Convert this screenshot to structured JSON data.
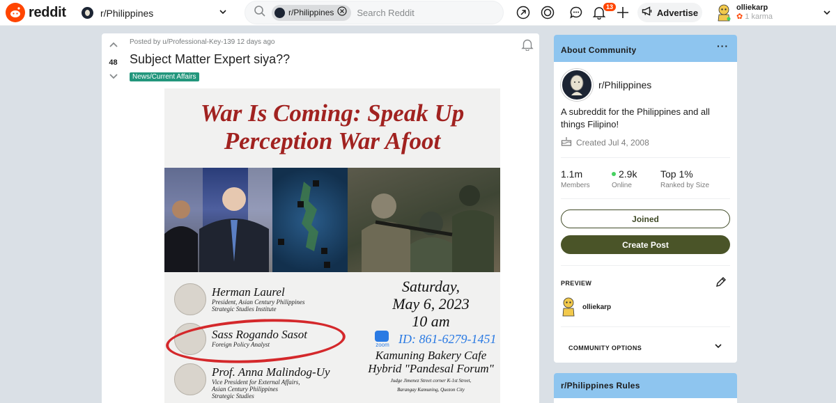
{
  "header": {
    "logo_text": "reddit",
    "community": "r/Philippines",
    "search_chip": "r/Philippines",
    "search_placeholder": "Search Reddit",
    "notification_count": "13",
    "advertise_label": "Advertise",
    "user_name": "olliekarp",
    "user_karma": "1 karma",
    "brand_color": "#ff4500"
  },
  "post": {
    "score": "48",
    "meta": "Posted by u/Professional-Key-139 12 days ago",
    "title": "Subject Matter Expert siya??",
    "flair": "News/Current Affairs",
    "flair_color": "#22967c",
    "image": {
      "headline_1": "War Is Coming: Speak Up",
      "headline_2": "Perception War Afoot",
      "speaker_1_name": "Herman Laurel",
      "speaker_1_role_1": "President, Asian Century Philippines",
      "speaker_1_role_2": "Strategic Studies Institute",
      "speaker_2_name": "Sass Rogando Sasot",
      "speaker_2_role": "Foreign Policy Analyst",
      "speaker_3_name": "Prof. Anna Malindog-Uy",
      "speaker_3_role_1": "Vice President for External Affairs,",
      "speaker_3_role_2": "Asian Century Philippines",
      "speaker_3_role_3": "Strategic Studies",
      "date_1": "Saturday,",
      "date_2": "May 6, 2023",
      "date_3": "10 am",
      "zoom_label": "zoom",
      "zoom_id": "ID: 861-6279-1451",
      "venue_1": "Kamuning Bakery Cafe",
      "venue_2": "Hybrid \"Pandesal Forum\"",
      "venue_3": "Judge Jimenez Street corner K-1st Street,",
      "venue_4": "Barangay Kamuning, Quezon City"
    }
  },
  "about": {
    "header": "About Community",
    "name": "r/Philippines",
    "description": "A subreddit for the Philippines and all things Filipino!",
    "created": "Created Jul 4, 2008",
    "members_value": "1.1m",
    "members_label": "Members",
    "online_value": "2.9k",
    "online_label": "Online",
    "rank_value": "Top 1%",
    "rank_label": "Ranked by Size",
    "joined_label": "Joined",
    "create_post_label": "Create Post",
    "preview_label": "PREVIEW",
    "preview_user": "olliekarp",
    "options_label": "COMMUNITY OPTIONS",
    "header_color": "#8ec5ef",
    "button_color": "#4a5428"
  },
  "rules": {
    "header": "r/Philippines Rules"
  }
}
